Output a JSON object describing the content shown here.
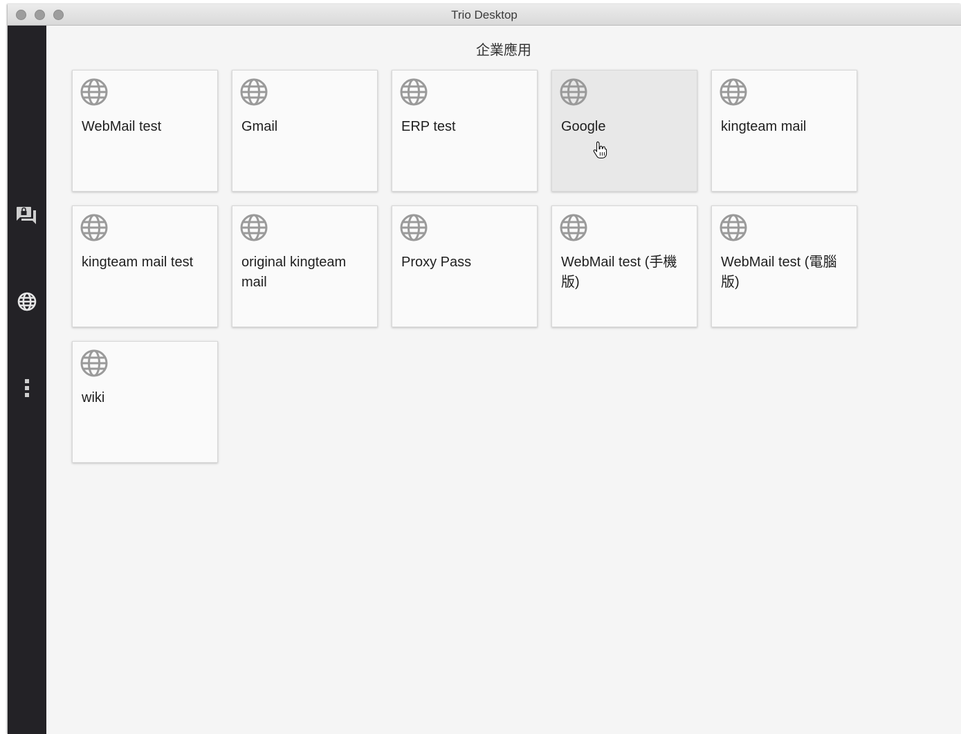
{
  "window": {
    "title": "Trio Desktop"
  },
  "sidebar": {
    "items": [
      {
        "icon": "chat-lock-icon"
      },
      {
        "icon": "globe-icon"
      },
      {
        "icon": "more-vertical-icon"
      }
    ]
  },
  "main": {
    "section_title": "企業應用",
    "apps": [
      {
        "label": "WebMail test",
        "icon": "globe-icon"
      },
      {
        "label": "Gmail",
        "icon": "globe-icon"
      },
      {
        "label": "ERP test",
        "icon": "globe-icon"
      },
      {
        "label": "Google",
        "icon": "globe-icon"
      },
      {
        "label": "kingteam mail",
        "icon": "globe-icon"
      },
      {
        "label": "kingteam mail test",
        "icon": "globe-icon"
      },
      {
        "label": "original kingteam mail",
        "icon": "globe-icon"
      },
      {
        "label": "Proxy Pass",
        "icon": "globe-icon"
      },
      {
        "label": "WebMail test (手機版)",
        "icon": "globe-icon"
      },
      {
        "label": "WebMail test (電腦版)",
        "icon": "globe-icon"
      },
      {
        "label": "wiki",
        "icon": "globe-icon"
      }
    ]
  },
  "colors": {
    "sidebar_bg": "#232226",
    "content_bg": "#f5f5f5",
    "card_bg": "#fafafa",
    "card_hover_bg": "#e8e8e8",
    "icon_gray": "#9a9a9a"
  }
}
